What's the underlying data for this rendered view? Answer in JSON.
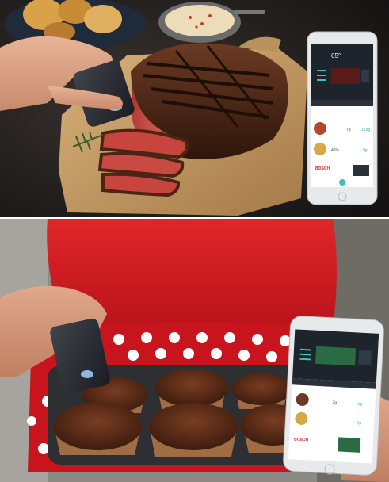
{
  "top_phone": {
    "temperature": "65°",
    "rows": [
      {
        "left": "7g",
        "right": "123g"
      },
      {
        "left": "45%",
        "right": "0g"
      }
    ],
    "brand": "BOSCH"
  },
  "bottom_phone": {
    "rows": [
      {
        "left": "3g",
        "right": "1g"
      },
      {
        "left": "",
        "right": "0g"
      }
    ],
    "brand": "BOSCH"
  },
  "colors": {
    "steak_crust": "#4a2414",
    "steak_pink": "#c9473f",
    "board": "#c49a63",
    "sweater_red": "#d4191b",
    "polka_red": "#c8141c",
    "muffin_brown": "#5a2c18",
    "phone_screen": "#1e242c",
    "sensor": "#2a2d34",
    "sensor_glow": "#5aa9ff"
  }
}
